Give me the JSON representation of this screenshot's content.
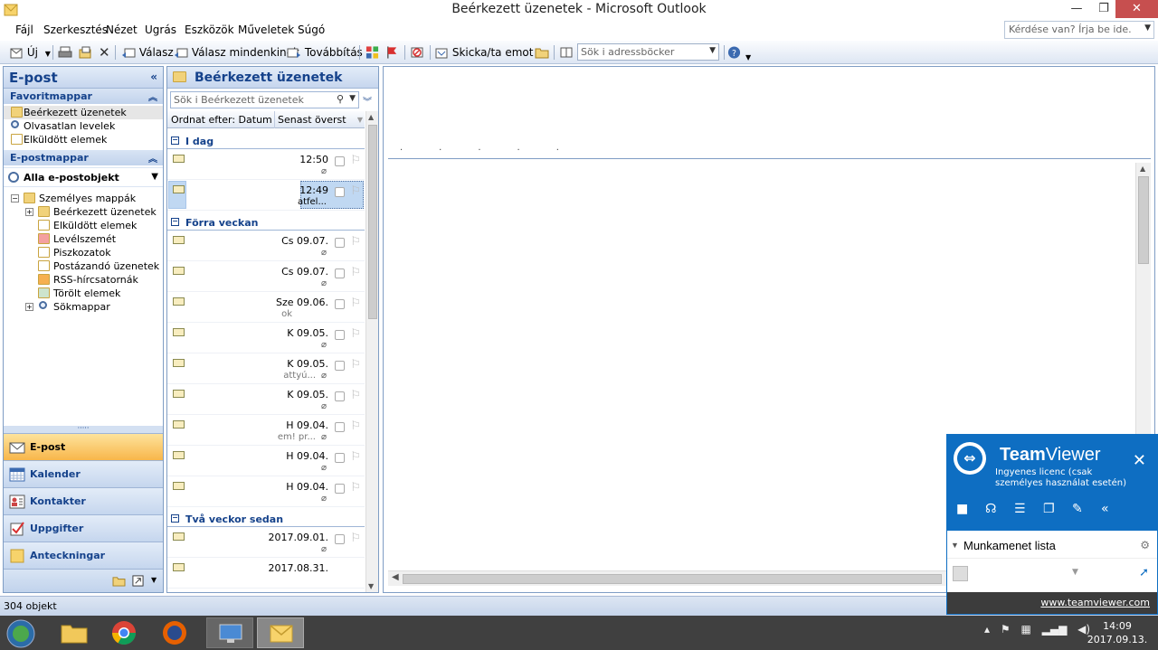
{
  "window": {
    "title": "Beérkezett üzenetek - Microsoft Outlook",
    "minimize": "—",
    "maximize": "❐",
    "close": "✕"
  },
  "menu": {
    "items": [
      "Fájl",
      "Szerkesztés",
      "Nézet",
      "Ugrás",
      "Eszközök",
      "Műveletek",
      "Súgó"
    ],
    "help_placeholder": "Kérdése van? Írja be ide."
  },
  "toolbar": {
    "new_label": "Új",
    "reply_label": "Válasz",
    "reply_all_label": "Válasz mindenkinek",
    "forward_label": "Továbbítás",
    "send_receive_label": "Skicka/ta emot",
    "address_search_placeholder": "Sök i adressböcker"
  },
  "nav": {
    "title": "E-post",
    "favorites_header": "Favoritmappar",
    "favorites": [
      "Beérkezett üzenetek",
      "Olvasatlan levelek",
      "Elküldött elemek"
    ],
    "mail_folders_header": "E-postmappar",
    "all_items": "Alla e-postobjekt",
    "tree_root": "Személyes mappák",
    "tree": [
      "Beérkezett üzenetek",
      "Elküldött elemek",
      "Levélszemét",
      "Piszkozatok",
      "Postázandó üzenetek",
      "RSS-hírcsatornák",
      "Törölt elemek",
      "Sökmappar"
    ],
    "buttons": [
      "E-post",
      "Kalender",
      "Kontakter",
      "Uppgifter",
      "Anteckningar"
    ]
  },
  "list": {
    "title": "Beérkezett üzenetek",
    "search_placeholder": "Sök i Beérkezett üzenetek",
    "arrange_by": "Ordnat efter: Datum",
    "sort_order": "Senast överst",
    "groups": [
      {
        "label": "I dag",
        "rows": [
          {
            "date": "12:50",
            "snippet": ""
          },
          {
            "date": "12:49",
            "snippet": "atfel..."
          }
        ]
      },
      {
        "label": "Förra veckan",
        "rows": [
          {
            "date": "Cs 09.07.",
            "snippet": ""
          },
          {
            "date": "Cs 09.07.",
            "snippet": ""
          },
          {
            "date": "Sze 09.06.",
            "snippet": "ok"
          },
          {
            "date": "K 09.05.",
            "snippet": ""
          },
          {
            "date": "K 09.05.",
            "snippet": "attyú..."
          },
          {
            "date": "K 09.05.",
            "snippet": ""
          },
          {
            "date": "H 09.04.",
            "snippet": "em! pr..."
          },
          {
            "date": "H 09.04.",
            "snippet": ""
          },
          {
            "date": "H 09.04.",
            "snippet": ""
          }
        ]
      },
      {
        "label": "Två veckor sedan",
        "rows": [
          {
            "date": "2017.09.01.",
            "snippet": ""
          },
          {
            "date": "2017.08.31.",
            "snippet": ""
          }
        ]
      }
    ]
  },
  "status": {
    "count": "304 objekt"
  },
  "teamviewer": {
    "brand_a": "Team",
    "brand_b": "Viewer",
    "license": "Ingyenes licenc (csak személyes használat esetén)",
    "session_list": "Munkamenet lista",
    "website": "www.teamviewer.com"
  },
  "taskbar": {
    "time": "14:09",
    "date": "2017.09.13."
  },
  "colors": {
    "outlook_blue": "#15428b",
    "teamviewer_blue": "#0e6ec2",
    "active_nav": "#f8b64a"
  }
}
